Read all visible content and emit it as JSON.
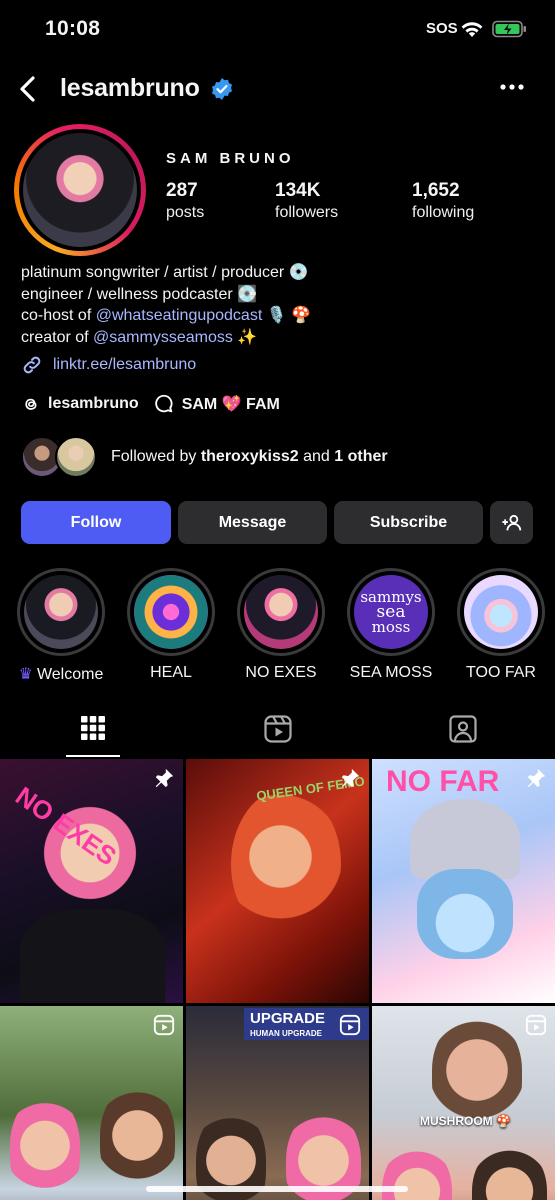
{
  "status_bar": {
    "time": "10:08",
    "sos": "SOS"
  },
  "header": {
    "username": "lesambruno"
  },
  "profile": {
    "display_name": "SAM BRUNO",
    "stats": [
      {
        "value": "287",
        "label": "posts"
      },
      {
        "value": "134K",
        "label": "followers"
      },
      {
        "value": "1,652",
        "label": "following"
      }
    ],
    "bio": {
      "line1": "platinum songwriter / artist / producer 💿",
      "line2": "engineer / wellness podcaster 💽",
      "line3_prefix": "co-host of ",
      "line3_mention": "@whatseatingupodcast",
      "line3_suffix": " 🎙️ 🍄",
      "line4_prefix": "creator of ",
      "line4_mention": "@sammysseamoss",
      "line4_suffix": " ✨"
    },
    "link": "linktr.ee/lesambruno",
    "threads_handle": "lesambruno",
    "channel": "SAM 💖 FAM",
    "followed_by": {
      "prefix": "Followed by ",
      "name": "theroxykiss2",
      "middle": " and ",
      "others": "1 other"
    }
  },
  "buttons": {
    "follow": "Follow",
    "message": "Message",
    "subscribe": "Subscribe"
  },
  "highlights": [
    {
      "label": "Welcome"
    },
    {
      "label": "HEAL"
    },
    {
      "label": "NO EXES"
    },
    {
      "label": "SEA MOSS"
    },
    {
      "label": "TOO FAR"
    }
  ],
  "highlight_texts": {
    "sea_moss_logo_1": "sammys",
    "sea_moss_logo_2": "sea",
    "sea_moss_logo_3": "moss"
  },
  "grid_texts": {
    "post1": "NO EXES",
    "post2": "QUEEN OF FEMO",
    "post3": "NO FAR",
    "post5": "UPGRADE",
    "post5_sub": "HUMAN UPGRADE",
    "post6": "MUSHROOM 🍄"
  },
  "colors": {
    "accent": "#4e5cf3",
    "link": "#a9b7ff",
    "verified": "#3897f0"
  }
}
